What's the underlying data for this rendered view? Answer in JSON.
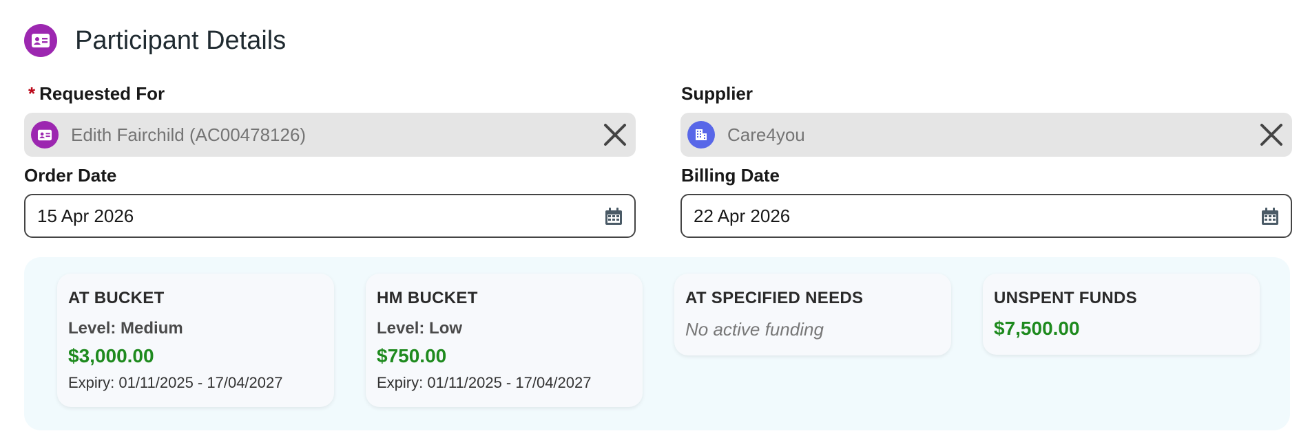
{
  "header": {
    "title": "Participant Details",
    "icon": "contact-card-icon"
  },
  "fields": {
    "requested_for": {
      "required_mark": "*",
      "label": "Requested For",
      "value": "Edith Fairchild (AC00478126)",
      "icon": "contact-card-icon"
    },
    "supplier": {
      "label": "Supplier",
      "value": "Care4you",
      "icon": "building-icon"
    },
    "order_date": {
      "label": "Order Date",
      "value": "15 Apr 2026"
    },
    "billing_date": {
      "label": "Billing Date",
      "value": "22 Apr 2026"
    }
  },
  "buckets": [
    {
      "title": "AT BUCKET",
      "level": "Level: Medium",
      "amount": "$3,000.00",
      "expiry": "Expiry: 01/11/2025 - 17/04/2027"
    },
    {
      "title": "HM BUCKET",
      "level": "Level: Low",
      "amount": "$750.00",
      "expiry": "Expiry: 01/11/2025 - 17/04/2027"
    },
    {
      "title": "AT SPECIFIED NEEDS",
      "empty_text": "No active funding"
    },
    {
      "title": "UNSPENT FUNDS",
      "amount": "$7,500.00"
    }
  ],
  "colors": {
    "accent_purple": "#9c27b0",
    "supplier_blue": "#5867e8",
    "amount_green": "#1e8a1e",
    "panel_bg": "#f1fafd"
  }
}
